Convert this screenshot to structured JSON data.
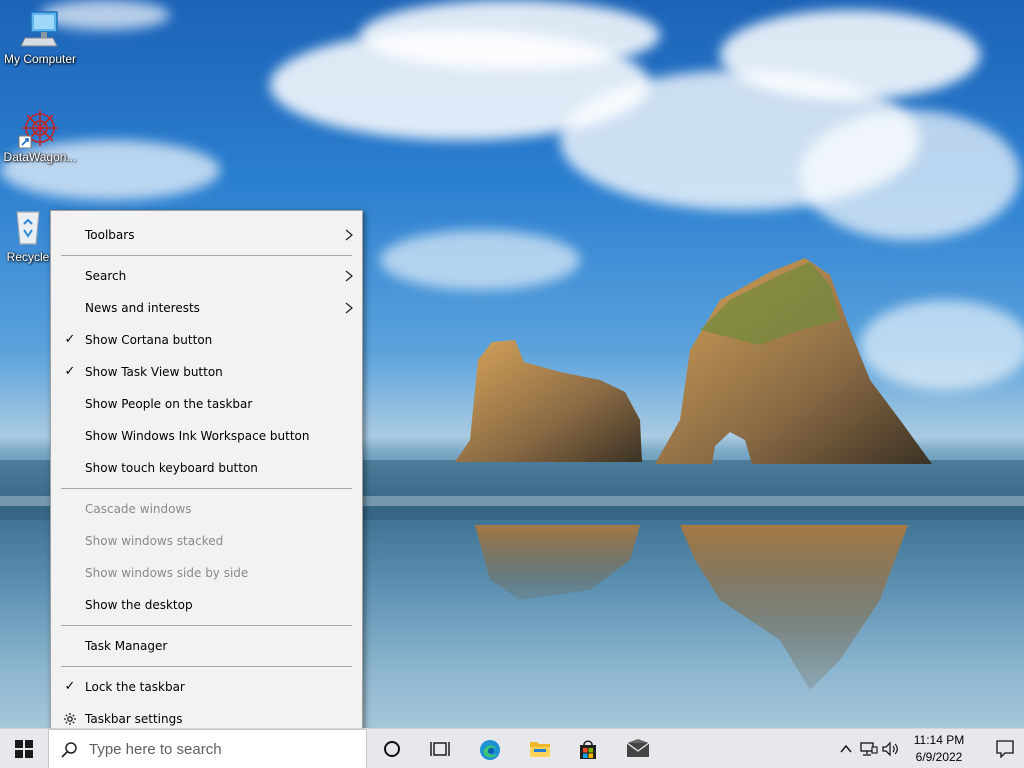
{
  "desktop": {
    "icons": [
      {
        "label": "My Computer"
      },
      {
        "label": "DataWagon..."
      },
      {
        "label": "Recycle"
      }
    ]
  },
  "context_menu": {
    "items": [
      {
        "label": "Toolbars",
        "checked": false,
        "submenu": true,
        "disabled": false
      },
      {
        "label": "Search",
        "checked": false,
        "submenu": true,
        "disabled": false
      },
      {
        "label": "News and interests",
        "checked": false,
        "submenu": true,
        "disabled": false
      },
      {
        "label": "Show Cortana button",
        "checked": true,
        "submenu": false,
        "disabled": false
      },
      {
        "label": "Show Task View button",
        "checked": true,
        "submenu": false,
        "disabled": false
      },
      {
        "label": "Show People on the taskbar",
        "checked": false,
        "submenu": false,
        "disabled": false
      },
      {
        "label": "Show Windows Ink Workspace button",
        "checked": false,
        "submenu": false,
        "disabled": false
      },
      {
        "label": "Show touch keyboard button",
        "checked": false,
        "submenu": false,
        "disabled": false
      },
      {
        "label": "Cascade windows",
        "checked": false,
        "submenu": false,
        "disabled": true
      },
      {
        "label": "Show windows stacked",
        "checked": false,
        "submenu": false,
        "disabled": true
      },
      {
        "label": "Show windows side by side",
        "checked": false,
        "submenu": false,
        "disabled": true
      },
      {
        "label": "Show the desktop",
        "checked": false,
        "submenu": false,
        "disabled": false
      },
      {
        "label": "Task Manager",
        "checked": false,
        "submenu": false,
        "disabled": false
      },
      {
        "label": "Lock the taskbar",
        "checked": true,
        "submenu": false,
        "disabled": false
      },
      {
        "label": "Taskbar settings",
        "checked": false,
        "submenu": false,
        "disabled": false
      }
    ],
    "check_glyph": "✓"
  },
  "taskbar": {
    "search_placeholder": "Type here to search",
    "pinned_apps": [
      "cortana-icon",
      "task-view-icon",
      "edge-icon",
      "file-explorer-icon",
      "store-icon",
      "mail-icon"
    ],
    "tray": {
      "time": "11:14 PM",
      "date": "6/9/2022"
    }
  },
  "colors": {
    "taskbar_bg": "#e6e8ec",
    "menu_bg": "#f2f2f2",
    "disabled_text": "#8a8a8a"
  }
}
